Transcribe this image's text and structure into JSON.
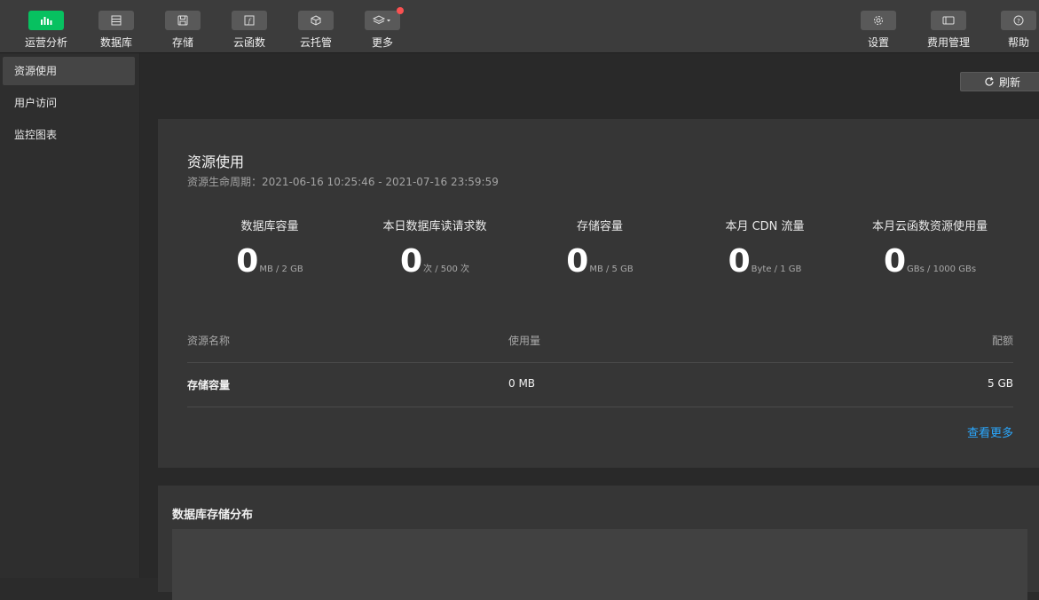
{
  "toolbar": {
    "left": [
      {
        "label": "运营分析",
        "icon": "bar-chart-icon",
        "active": true
      },
      {
        "label": "数据库",
        "icon": "database-icon"
      },
      {
        "label": "存储",
        "icon": "storage-icon"
      },
      {
        "label": "云函数",
        "icon": "function-icon"
      },
      {
        "label": "云托管",
        "icon": "cube-icon"
      },
      {
        "label": "更多",
        "icon": "layers-icon"
      }
    ],
    "right": [
      {
        "label": "设置",
        "icon": "gear-icon"
      },
      {
        "label": "费用管理",
        "icon": "billing-icon"
      },
      {
        "label": "帮助",
        "icon": "help-icon"
      }
    ]
  },
  "sidebar": {
    "items": [
      {
        "label": "资源使用"
      },
      {
        "label": "用户访问"
      },
      {
        "label": "监控图表"
      }
    ]
  },
  "main": {
    "refresh_label": "刷新",
    "card": {
      "title": "资源使用",
      "subtitle": "资源生命周期：2021-06-16 10:25:46 - 2021-07-16 23:59:59",
      "metrics": [
        {
          "label": "数据库容量",
          "value": "0",
          "unit": "MB / 2 GB"
        },
        {
          "label": "本日数据库读请求数",
          "value": "0",
          "unit": "次 / 500 次"
        },
        {
          "label": "存储容量",
          "value": "0",
          "unit": "MB / 5 GB"
        },
        {
          "label": "本月 CDN 流量",
          "value": "0",
          "unit": "Byte / 1 GB"
        },
        {
          "label": "本月云函数资源使用量",
          "value": "0",
          "unit": "GBs / 1000 GBs"
        }
      ],
      "table": {
        "headers": [
          "资源名称",
          "使用量",
          "配额"
        ],
        "rows": [
          [
            "存储容量",
            "0 MB",
            "5 GB"
          ]
        ]
      },
      "more_link": "查看更多"
    },
    "card2": {
      "title": "数据库存储分布"
    }
  }
}
